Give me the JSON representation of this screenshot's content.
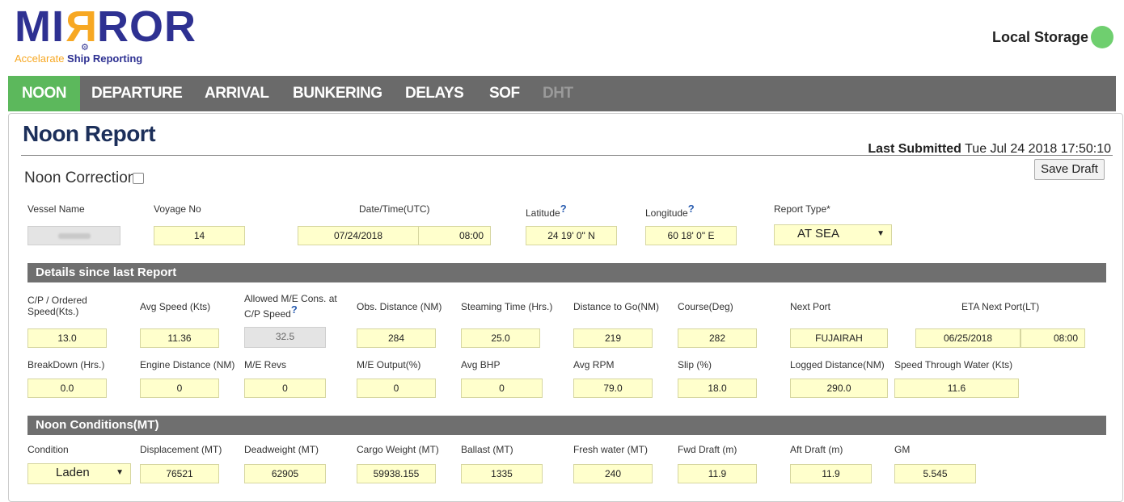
{
  "brand": {
    "logo": "MIRROR",
    "tagline_a": "Accelarate",
    "tagline_b": "Ship Reporting"
  },
  "storage": {
    "label": "Local Storage",
    "status_color": "#6fcf6f"
  },
  "nav": {
    "items": [
      {
        "label": "NOON"
      },
      {
        "label": "DEPARTURE"
      },
      {
        "label": "ARRIVAL"
      },
      {
        "label": "BUNKERING"
      },
      {
        "label": "DELAYS"
      },
      {
        "label": "SOF"
      },
      {
        "label": "DHT"
      }
    ],
    "active": "NOON",
    "active_color": "#5cb85c"
  },
  "page": {
    "title": "Noon Report",
    "last_submitted_label": "Last Submitted",
    "last_submitted_value": "Tue Jul 24 2018 17:50:10",
    "save_draft": "Save Draft",
    "noon_correction": "Noon Correction"
  },
  "header_fields": {
    "vessel_name_label": "Vessel Name",
    "voyage_no_label": "Voyage No",
    "voyage_no": "14",
    "datetime_label": "Date/Time(UTC)",
    "date": "07/24/2018",
    "time": "08:00",
    "latitude_label": "Latitude",
    "latitude": "24 19' 0\" N",
    "longitude_label": "Longitude",
    "longitude": "60 18' 0\" E",
    "report_type_label": "Report Type*",
    "report_type": "AT SEA",
    "help": "?"
  },
  "details": {
    "section_title": "Details since last Report",
    "cp_speed_label": "C/P / Ordered Speed(Kts.)",
    "cp_speed": "13.0",
    "avg_speed_label": "Avg Speed (Kts)",
    "avg_speed": "11.36",
    "allowed_me_label": "Allowed M/E Cons. at C/P Speed",
    "allowed_me": "32.5",
    "obs_distance_label": "Obs. Distance (NM)",
    "obs_distance": "284",
    "steaming_time_label": "Steaming Time (Hrs.)",
    "steaming_time": "25.0",
    "distance_to_go_label": "Distance to Go(NM)",
    "distance_to_go": "219",
    "course_label": "Course(Deg)",
    "course": "282",
    "next_port_label": "Next Port",
    "next_port": "FUJAIRAH",
    "eta_label": "ETA Next Port(LT)",
    "eta_date": "06/25/2018",
    "eta_time": "08:00",
    "breakdown_label": "BreakDown (Hrs.)",
    "breakdown": "0.0",
    "engine_distance_label": "Engine Distance (NM)",
    "engine_distance": "0",
    "me_revs_label": "M/E Revs",
    "me_revs": "0",
    "me_output_label": "M/E Output(%)",
    "me_output": "0",
    "avg_bhp_label": "Avg BHP",
    "avg_bhp": "0",
    "avg_rpm_label": "Avg RPM",
    "avg_rpm": "79.0",
    "slip_label": "Slip (%)",
    "slip": "18.0",
    "logged_distance_label": "Logged Distance(NM)",
    "logged_distance": "290.0",
    "stw_label": "Speed Through Water (Kts)",
    "stw": "11.6"
  },
  "conditions": {
    "section_title": "Noon Conditions(MT)",
    "condition_label": "Condition",
    "condition": "Laden",
    "displacement_label": "Displacement (MT)",
    "displacement": "76521",
    "deadweight_label": "Deadweight (MT)",
    "deadweight": "62905",
    "cargo_weight_label": "Cargo Weight (MT)",
    "cargo_weight": "59938.155",
    "ballast_label": "Ballast (MT)",
    "ballast": "1335",
    "fresh_water_label": "Fresh water (MT)",
    "fresh_water": "240",
    "fwd_draft_label": "Fwd Draft (m)",
    "fwd_draft": "11.9",
    "aft_draft_label": "Aft Draft (m)",
    "aft_draft": "11.9",
    "gm_label": "GM",
    "gm": "5.545"
  }
}
